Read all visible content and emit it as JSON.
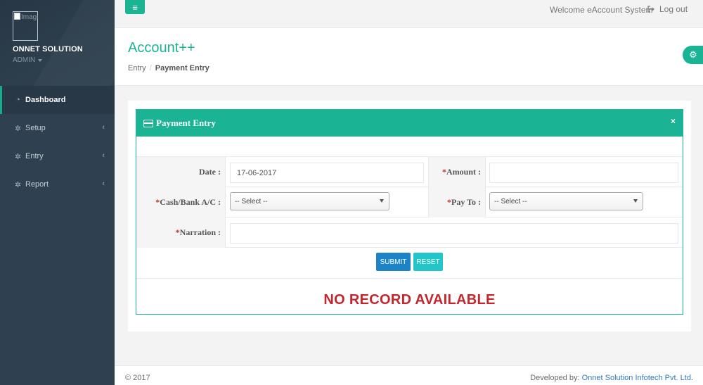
{
  "sidebar": {
    "avatar_alt": "Image",
    "org_name": "ONNET SOLUTION",
    "role": "ADMIN",
    "items": [
      {
        "label": "Dashboard",
        "icon": "dashboard-icon"
      },
      {
        "label": "Setup",
        "icon": "gear-icon"
      },
      {
        "label": "Entry",
        "icon": "gear-icon"
      },
      {
        "label": "Report",
        "icon": "gear-icon"
      }
    ]
  },
  "topbar": {
    "menu_icon": "≡",
    "welcome": "Welcome eAccount System",
    "logout": "Log out"
  },
  "heading": {
    "title": "Account++",
    "breadcrumb": [
      "Entry",
      "Payment Entry"
    ]
  },
  "panel": {
    "title": "Payment Entry",
    "close": "×",
    "fields": {
      "date_label": "Date :",
      "date_value": "17-06-2017",
      "amount_label": "Amount :",
      "amount_value": "",
      "cashbank_label": "Cash/Bank A/C :",
      "cashbank_value": "-- Select --",
      "payto_label": "Pay To :",
      "payto_value": "-- Select --",
      "narration_label": "Narration :",
      "narration_value": ""
    },
    "required_mark": "*",
    "submit_label": "SUBMIT",
    "reset_label": "RESET",
    "empty_message": "NO RECORD AVAILABLE"
  },
  "footer": {
    "copyright": "© 2017",
    "developed_by": "Developed by: ",
    "company": "Onnet Solution Infotech Pvt. Ltd."
  },
  "colors": {
    "accent": "#1ab394",
    "sidebar": "#2f4050",
    "submit": "#1c84c6",
    "reset": "#23c6c8",
    "error": "#c0282d"
  }
}
